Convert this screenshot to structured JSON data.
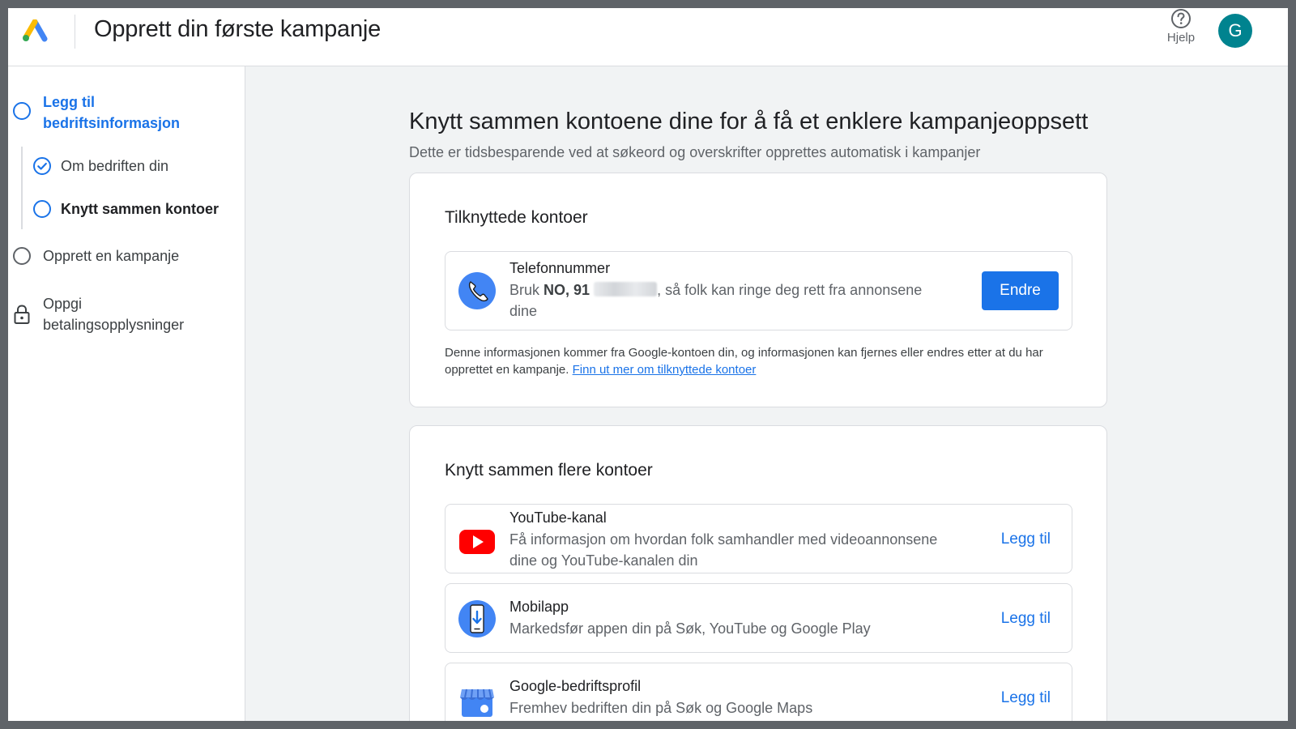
{
  "header": {
    "title": "Opprett din første kampanje",
    "help_label": "Hjelp",
    "avatar_initial": "G"
  },
  "sidebar": {
    "steps": [
      {
        "label": "Legg til bedriftsinformasjon",
        "state": "active"
      },
      {
        "label": "Om bedriften din",
        "state": "done"
      },
      {
        "label": "Knytt sammen kontoer",
        "state": "current"
      },
      {
        "label": "Opprett en kampanje",
        "state": "todo"
      },
      {
        "label": "Oppgi betalingsopplysninger",
        "state": "locked"
      }
    ]
  },
  "main": {
    "title": "Knytt sammen kontoene dine for å få et enklere kampanjeoppsett",
    "subtitle": "Dette er tidsbesparende ved at søkeord og overskrifter opprettes automatisk i kampanjer"
  },
  "linked_card": {
    "title": "Tilknyttede kontoer",
    "phone": {
      "name": "Telefonnummer",
      "desc_prefix": "Bruk ",
      "desc_number": "NO, 91",
      "desc_suffix": ", så folk kan ringe deg rett fra annonsene dine",
      "button": "Endre"
    },
    "info_text": "Denne informasjonen kommer fra Google-kontoen din, og informasjonen kan fjernes eller endres etter at du har opprettet en kampanje. ",
    "info_link": "Finn ut mer om tilknyttede kontoer"
  },
  "more_card": {
    "title": "Knytt sammen flere kontoer",
    "accounts": [
      {
        "name": "YouTube-kanal",
        "desc": "Få informasjon om hvordan folk samhandler med videoannonsene dine og YouTube-kanalen din",
        "action": "Legg til"
      },
      {
        "name": "Mobilapp",
        "desc": "Markedsfør appen din på Søk, YouTube og Google Play",
        "action": "Legg til"
      },
      {
        "name": "Google-bedriftsprofil",
        "desc": "Fremhev bedriften din på Søk og Google Maps",
        "action": "Legg til"
      }
    ]
  },
  "colors": {
    "accent": "#1a73e8",
    "avatar": "#00838f",
    "youtube": "#ff0000"
  },
  "icons": [
    "google-ads-logo",
    "help-icon",
    "check-circle-icon",
    "lock-icon",
    "phone-icon",
    "youtube-icon",
    "mobile-app-icon",
    "business-profile-icon"
  ]
}
